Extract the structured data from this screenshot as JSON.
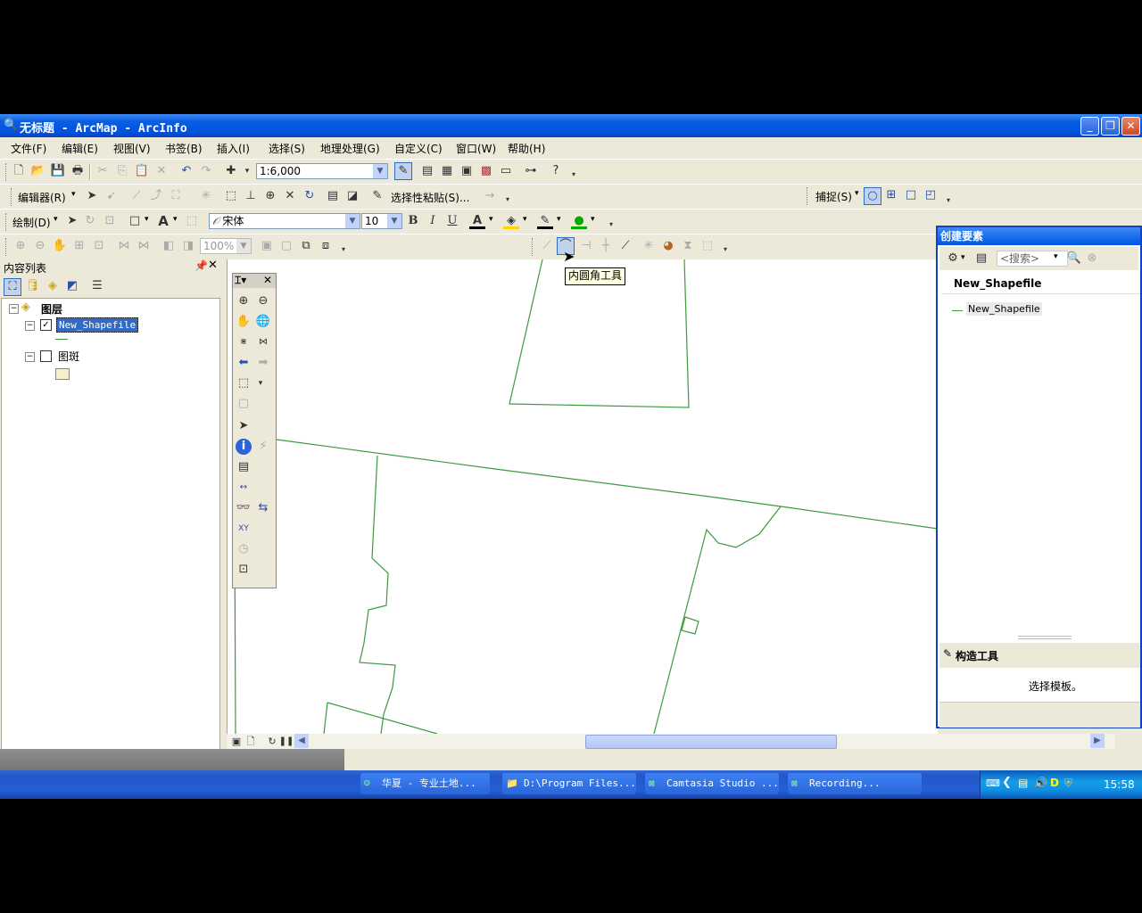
{
  "window": {
    "title": "无标题 - ArcMap - ArcInfo",
    "minimize": "_",
    "maximize": "❐",
    "close": "✕"
  },
  "menu": [
    "文件(F)",
    "编辑(E)",
    "视图(V)",
    "书签(B)",
    "插入(I)",
    "选择(S)",
    "地理处理(G)",
    "自定义(C)",
    "窗口(W)",
    "帮助(H)"
  ],
  "toolbar_standard": {
    "scale": "1:6,000"
  },
  "toolbar_editor": {
    "editor_label": "编辑器(R)",
    "paste_label": "选择性粘贴(S)...",
    "snapping_label": "捕捉(S)"
  },
  "toolbar_draw": {
    "draw_label": "绘制(D)",
    "font": "宋体",
    "font_size": "10",
    "bold": "B",
    "italic": "I",
    "underline": "U"
  },
  "toolbar_layout": {
    "zoom": "100%"
  },
  "tooltip": "内圆角工具",
  "toc": {
    "title": "内容列表",
    "root": "图层",
    "layers": [
      {
        "name": "New_Shapefile",
        "checked": true,
        "selected": true
      },
      {
        "name": "图斑",
        "checked": false,
        "selected": false
      }
    ]
  },
  "create_features": {
    "title": "创建要素",
    "search_placeholder": "<搜索>",
    "group": "New_Shapefile",
    "template": "New_Shapefile",
    "construction_title": "构造工具",
    "construction_hint": "选择模板。"
  },
  "taskbar": {
    "tasks": [
      "华夏 - 专业土地...",
      "D:\\Program Files...",
      "Camtasia Studio ...",
      "Recording..."
    ],
    "clock": "15:58"
  },
  "colors": {
    "feature_line": "#3c9a3c",
    "titlebar": "#0054e3",
    "selection": "#316ac5"
  }
}
